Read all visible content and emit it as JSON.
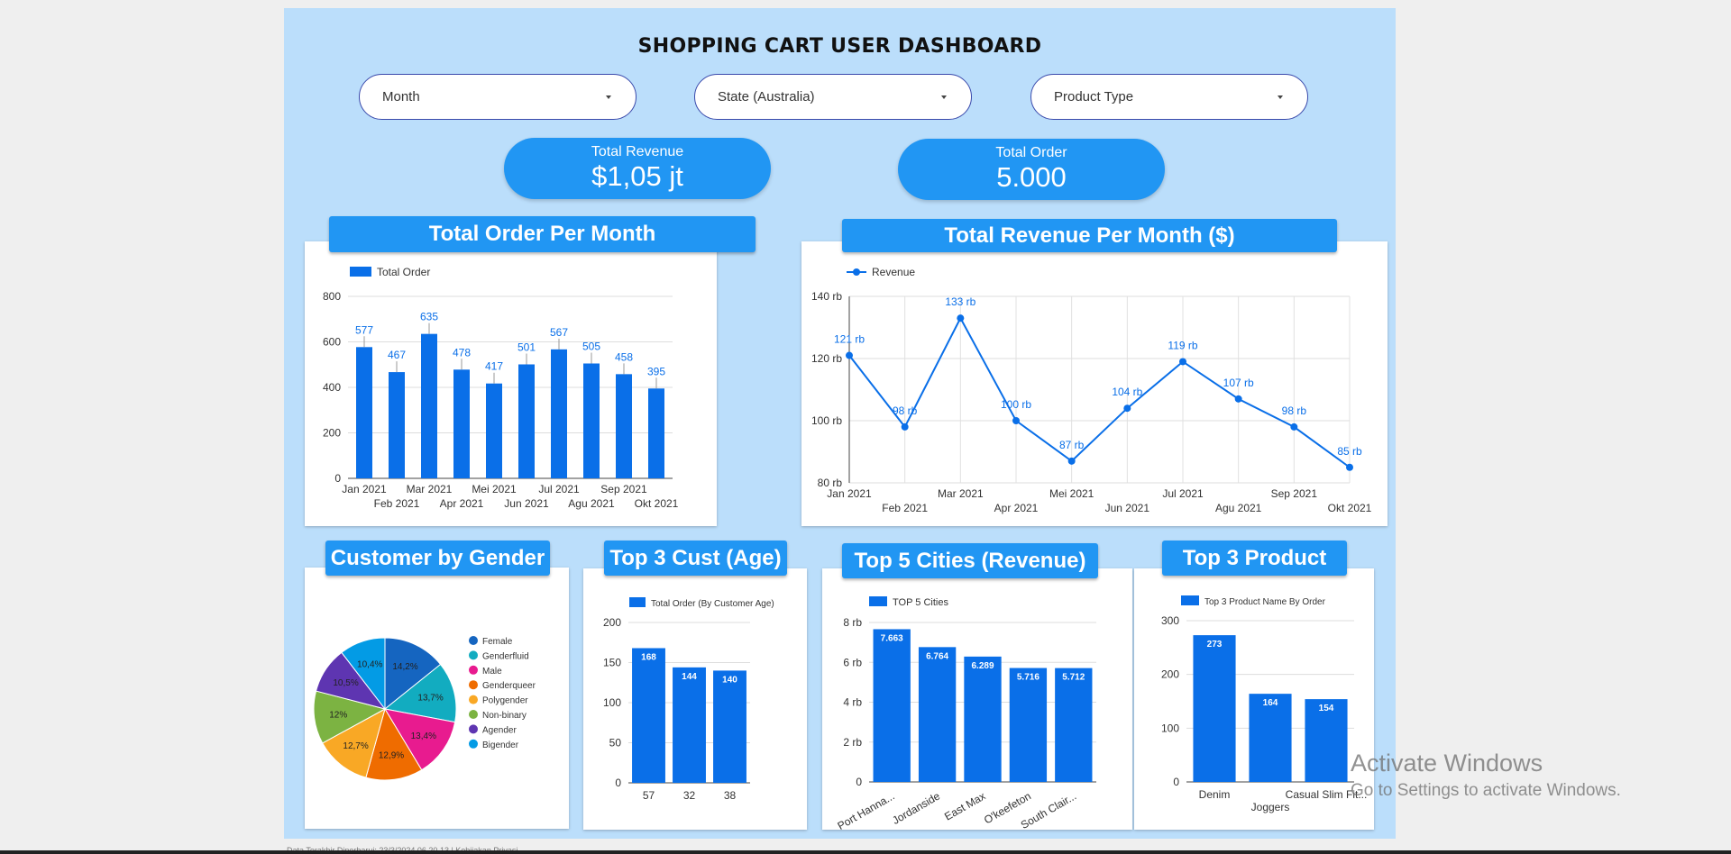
{
  "header": {
    "title": "SHOPPING CART USER DASHBOARD"
  },
  "filters": [
    {
      "label": "Month"
    },
    {
      "label": "State (Australia)"
    },
    {
      "label": "Product Type"
    }
  ],
  "kpis": {
    "revenue": {
      "label": "Total Revenue",
      "value": "$1,05 jt"
    },
    "orders": {
      "label": "Total Order",
      "value": "5.000"
    }
  },
  "panels": {
    "order_month": "Total Order Per Month",
    "revenue_month": "Total Revenue Per Month ($)",
    "gender": "Customer by Gender",
    "age": "Top 3 Cust (Age)",
    "cities": "Top 5 Cities (Revenue)",
    "product": "Top 3 Product"
  },
  "colors": {
    "bar": "#0a6fe8",
    "banner": "#2196f3",
    "background": "#bbdefb"
  },
  "chart_data": [
    {
      "id": "order_month",
      "type": "bar",
      "legend": "Total Order",
      "categories": [
        "Jan 2021",
        "Feb 2021",
        "Mar 2021",
        "Apr 2021",
        "Mei 2021",
        "Jun 2021",
        "Jul 2021",
        "Agu 2021",
        "Sep 2021",
        "Okt 2021"
      ],
      "values": [
        577,
        467,
        635,
        478,
        417,
        501,
        567,
        505,
        458,
        395
      ],
      "value_labels": [
        "577",
        "467",
        "635",
        "478",
        "417",
        "501",
        "567",
        "505",
        "458",
        "395"
      ],
      "yticks": [
        "0",
        "200",
        "400",
        "600",
        "800"
      ],
      "ylim": [
        0,
        800
      ],
      "grid": true
    },
    {
      "id": "revenue_month",
      "type": "line",
      "legend": "Revenue",
      "categories": [
        "Jan 2021",
        "Feb 2021",
        "Mar 2021",
        "Apr 2021",
        "Mei 2021",
        "Jun 2021",
        "Jul 2021",
        "Agu 2021",
        "Sep 2021",
        "Okt 2021"
      ],
      "values": [
        121,
        98,
        133,
        100,
        87,
        104,
        119,
        107,
        98,
        85
      ],
      "value_labels": [
        "121 rb",
        "98 rb",
        "133 rb",
        "100 rb",
        "87 rb",
        "104 rb",
        "119 rb",
        "107 rb",
        "98 rb",
        "85 rb"
      ],
      "yticks": [
        "80 rb",
        "100 rb",
        "120 rb",
        "140 rb"
      ],
      "ylim": [
        80,
        140
      ],
      "grid": true
    },
    {
      "id": "gender",
      "type": "pie",
      "categories": [
        "Female",
        "Genderfluid",
        "Male",
        "Genderqueer",
        "Polygender",
        "Non-binary",
        "Agender",
        "Bigender"
      ],
      "values": [
        14.2,
        13.7,
        13.4,
        12.9,
        12.7,
        12,
        10.5,
        10.4
      ],
      "value_labels": [
        "14,2%",
        "13,7%",
        "13,4%",
        "12,9%",
        "12,7%",
        "12%",
        "10,5%",
        "10,4%"
      ],
      "colors": [
        "#1565c0",
        "#12acc0",
        "#e81b8f",
        "#ef6c00",
        "#f9a825",
        "#7cb342",
        "#5e35b1",
        "#039be5"
      ]
    },
    {
      "id": "age",
      "type": "bar",
      "legend": "Total Order (By Customer Age)",
      "categories": [
        "57",
        "32",
        "38"
      ],
      "values": [
        168,
        144,
        140
      ],
      "value_labels": [
        "168",
        "144",
        "140"
      ],
      "yticks": [
        "0",
        "50",
        "100",
        "150",
        "200"
      ],
      "ylim": [
        0,
        200
      ],
      "grid": true
    },
    {
      "id": "cities",
      "type": "bar",
      "legend": "TOP 5 Cities",
      "categories": [
        "Port Hanna...",
        "Jordanside",
        "East Max",
        "O'keefeton",
        "South Clair..."
      ],
      "values": [
        7.663,
        6.764,
        6.289,
        5.716,
        5.712
      ],
      "value_labels": [
        "7.663",
        "6.764",
        "6.289",
        "5.716",
        "5.712"
      ],
      "yticks": [
        "0",
        "2 rb",
        "4 rb",
        "6 rb",
        "8 rb"
      ],
      "ylim": [
        0,
        8
      ],
      "grid": true
    },
    {
      "id": "product",
      "type": "bar",
      "legend": "Top 3 Product Name By Order",
      "categories": [
        "Denim",
        "Joggers",
        "Casual Slim Fit..."
      ],
      "values": [
        273,
        164,
        154
      ],
      "value_labels": [
        "273",
        "164",
        "154"
      ],
      "yticks": [
        "0",
        "100",
        "200",
        "300"
      ],
      "ylim": [
        0,
        300
      ],
      "grid": true
    }
  ],
  "footer": {
    "text": "Data Terakhir Diperbarui: 23/3/2024 06.20.13  |  Kebijakan Privasi"
  },
  "watermark": {
    "line1": "Activate Windows",
    "line2": "Go to Settings to activate Windows."
  }
}
